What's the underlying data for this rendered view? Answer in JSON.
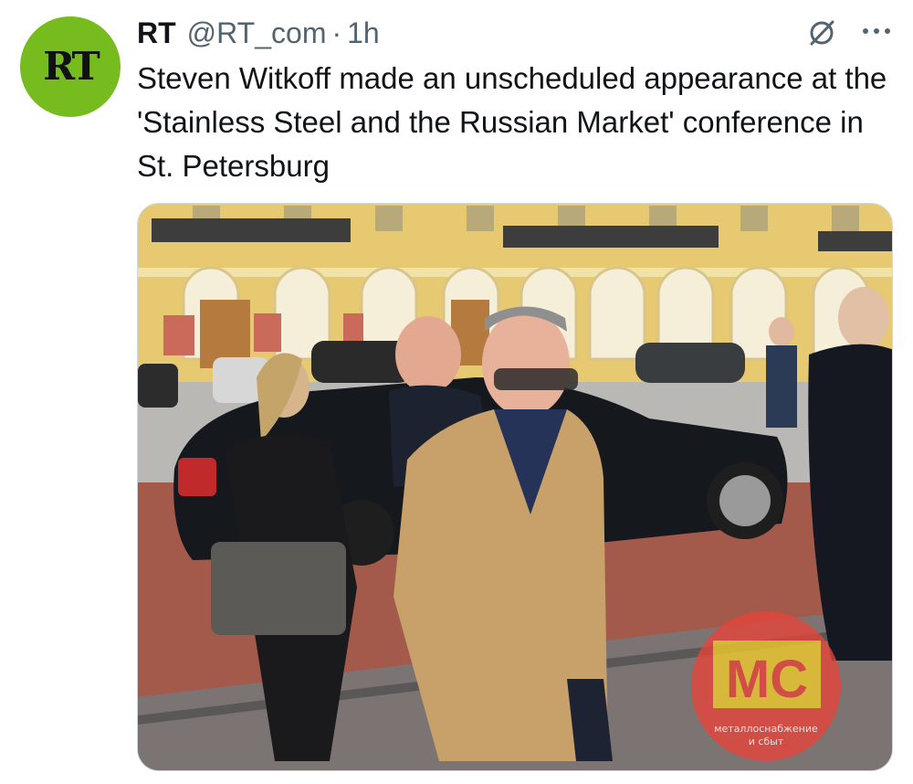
{
  "author": {
    "name": "RT",
    "handle": "@RT_com",
    "separator": "·",
    "time": "1h",
    "avatar_text": "RT",
    "avatar_color": "#77bc1f"
  },
  "tweet": {
    "text": "Steven Witkoff made an unscheduled appearance at the 'Stainless Steel and the Russian Market' conference in St. Petersburg"
  },
  "actions": {
    "grok_icon": "grok-slash-icon",
    "more_icon": "more-dots-icon"
  },
  "media": {
    "description_icon": "photo",
    "watermark": {
      "text": "MC",
      "caption_line1": "металлоснабжение",
      "caption_line2": "и сбыт",
      "color": "#e8443a"
    }
  }
}
